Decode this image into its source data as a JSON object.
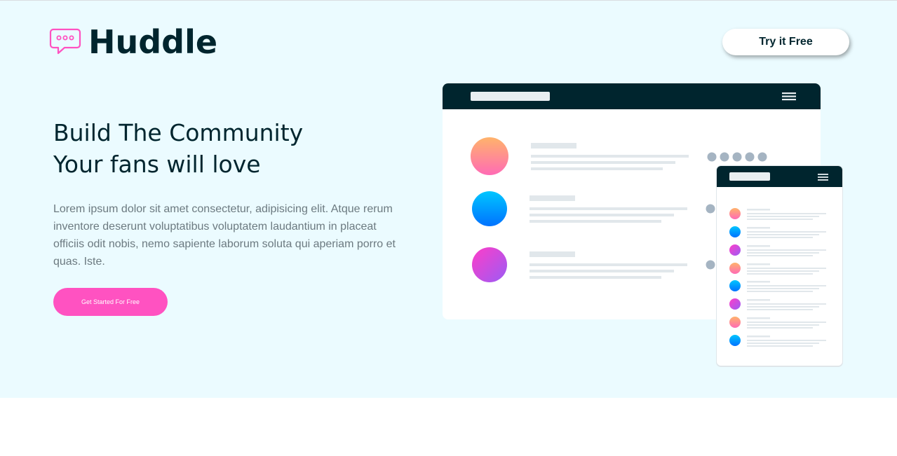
{
  "brand": {
    "name": "Huddle"
  },
  "header": {
    "cta_label": "Try it Free"
  },
  "hero": {
    "headline_line1": "Build The Community",
    "headline_line2": "Your fans will love",
    "description": "Lorem ipsum dolor sit amet consectetur, adipisicing elit. Atque rerum inventore deserunt voluptatibus voluptatem laudantium in placeat officiis odit nobis, nemo sapiente laborum soluta qui aperiam porro et quas. Iste.",
    "cta_label": "Get Started For Free"
  },
  "colors": {
    "hero_bg": "#ebfbff",
    "dark": "#00252e",
    "accent_pink": "#ff52c1",
    "text_gray": "#6c7a80"
  },
  "icons": {
    "logo": "speech-bubble-icon",
    "menu": "hamburger-menu-icon"
  }
}
